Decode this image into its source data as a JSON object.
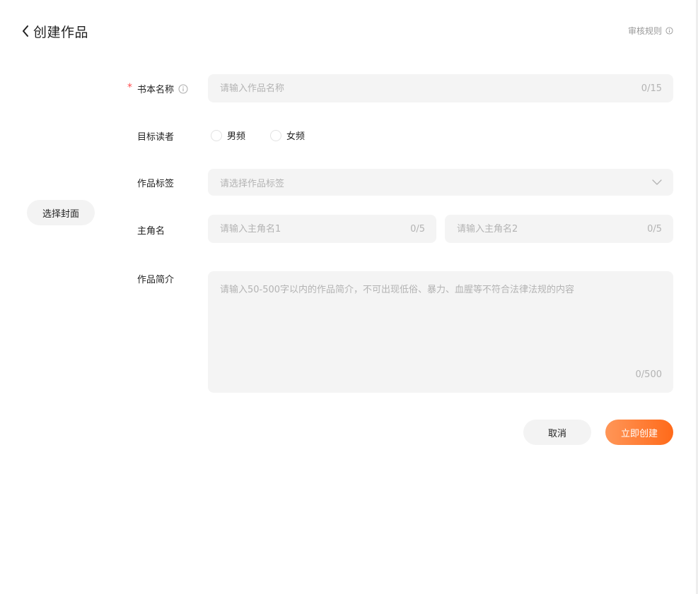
{
  "header": {
    "title": "创建作品",
    "back_icon": "chevron-left-icon",
    "rules_label": "审核规则",
    "rules_icon": "info-circle-icon"
  },
  "cover": {
    "button_label": "选择封面"
  },
  "form": {
    "book_name": {
      "required_mark": "*",
      "label": "书本名称",
      "info_icon": "info-circle-icon",
      "placeholder": "请输入作品名称",
      "value": "",
      "counter": "0/15"
    },
    "audience": {
      "label": "目标读者",
      "options": [
        "男频",
        "女频"
      ],
      "selected": null
    },
    "tags": {
      "label": "作品标签",
      "placeholder": "请选择作品标签",
      "dropdown_icon": "chevron-down-icon"
    },
    "protagonist": {
      "label": "主角名",
      "field1": {
        "placeholder": "请输入主角名1",
        "value": "",
        "counter": "0/5"
      },
      "field2": {
        "placeholder": "请输入主角名2",
        "value": "",
        "counter": "0/5"
      }
    },
    "synopsis": {
      "label": "作品简介",
      "placeholder": "请输入50-500字以内的作品简介，不可出现低俗、暴力、血腥等不符合法律法规的内容",
      "value": "",
      "counter": "0/500"
    }
  },
  "actions": {
    "cancel_label": "取消",
    "create_label": "立即创建"
  },
  "colors": {
    "accent_start": "#ff9658",
    "accent_end": "#ff6a1a",
    "required": "#ff4d4f",
    "field_bg": "#f4f4f4",
    "placeholder": "#b3b3b3"
  }
}
